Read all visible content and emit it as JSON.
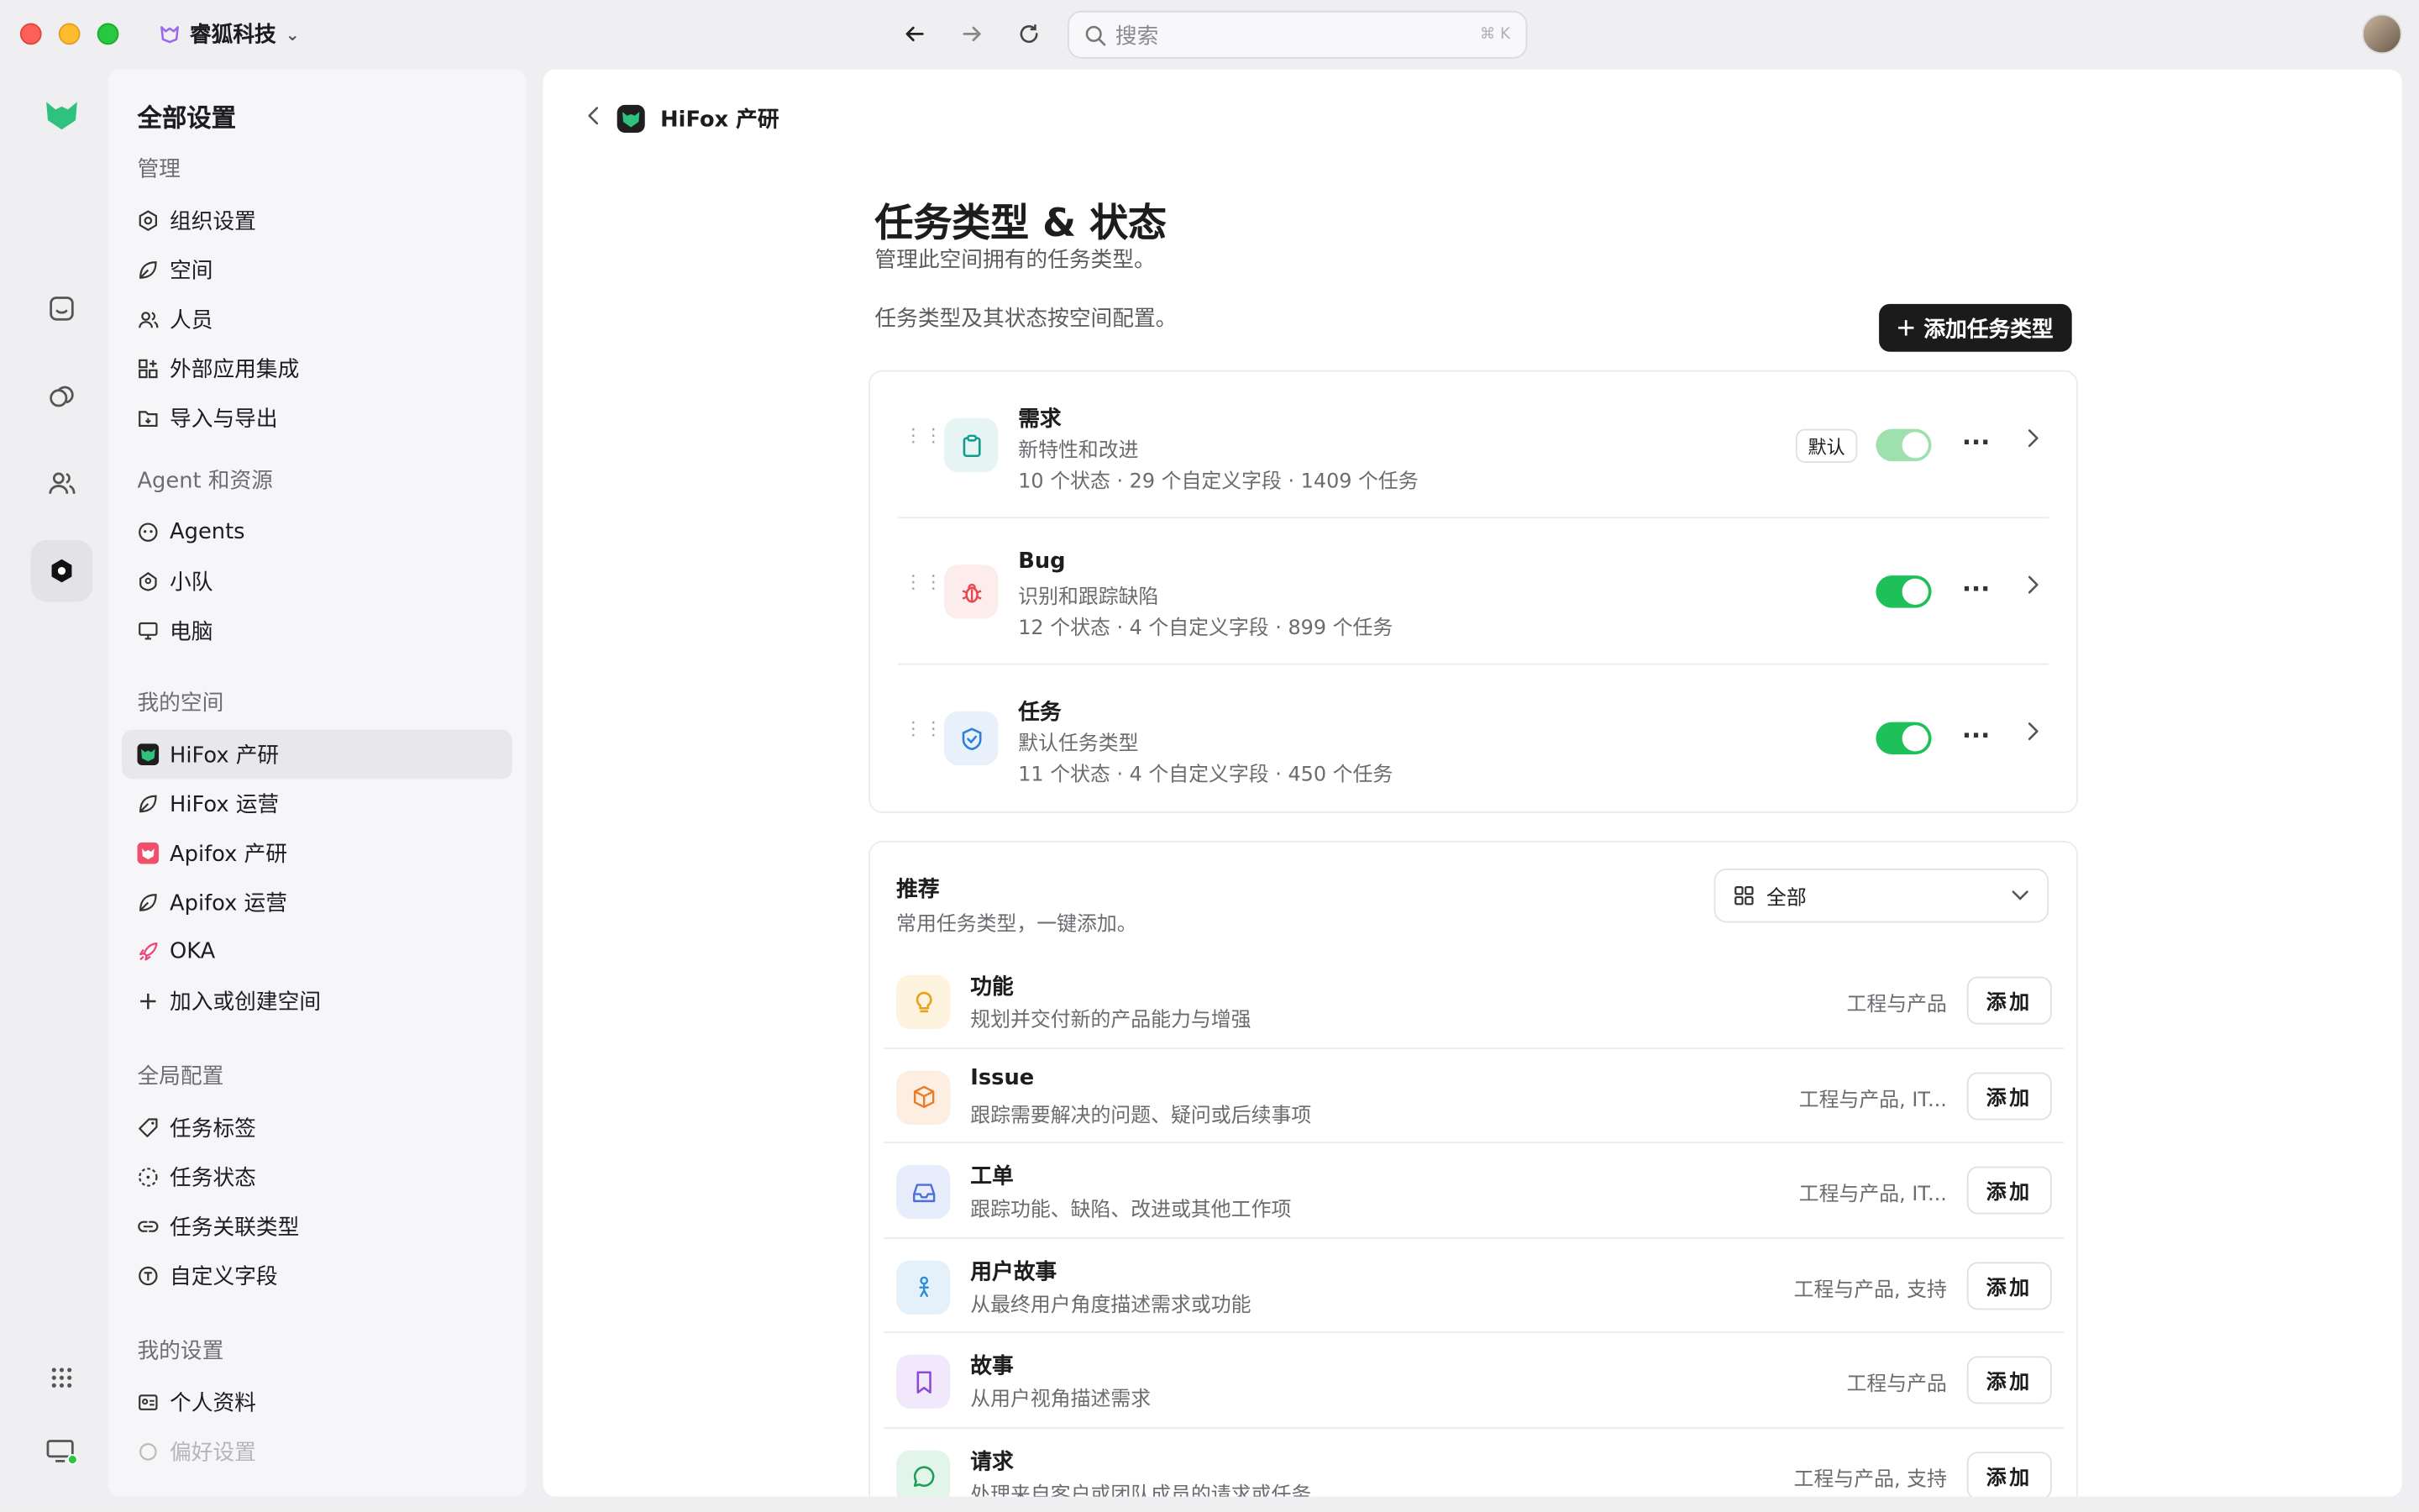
{
  "window": {
    "org_name": "睿狐科技"
  },
  "search": {
    "placeholder": "搜索",
    "shortcut": "⌘ K"
  },
  "sidebar": {
    "title": "全部设置",
    "sections": [
      {
        "label": "管理",
        "items": [
          {
            "label": "组织设置",
            "icon": "gear-icon"
          },
          {
            "label": "空间",
            "icon": "leaf-icon"
          },
          {
            "label": "人员",
            "icon": "people-icon"
          },
          {
            "label": "外部应用集成",
            "icon": "apps-icon"
          },
          {
            "label": "导入与导出",
            "icon": "folder-icon"
          }
        ]
      },
      {
        "label": "Agent 和资源",
        "items": [
          {
            "label": "Agents",
            "icon": "agent-icon"
          },
          {
            "label": "小队",
            "icon": "team-icon"
          },
          {
            "label": "电脑",
            "icon": "monitor-icon"
          }
        ]
      },
      {
        "label": "我的空间",
        "items": [
          {
            "label": "HiFox 产研",
            "icon": "hifox-logo-icon",
            "active": true
          },
          {
            "label": "HiFox 运营",
            "icon": "leaf-icon"
          },
          {
            "label": "Apifox 产研",
            "icon": "apifox-logo-icon"
          },
          {
            "label": "Apifox 运营",
            "icon": "leaf-icon"
          },
          {
            "label": "OKA",
            "icon": "rocket-icon"
          },
          {
            "label": "加入或创建空间",
            "icon": "plus-icon"
          }
        ]
      },
      {
        "label": "全局配置",
        "items": [
          {
            "label": "任务标签",
            "icon": "tag-icon"
          },
          {
            "label": "任务状态",
            "icon": "status-icon"
          },
          {
            "label": "任务关联类型",
            "icon": "link-icon"
          },
          {
            "label": "自定义字段",
            "icon": "field-icon"
          }
        ]
      },
      {
        "label": "我的设置",
        "items": [
          {
            "label": "个人资料",
            "icon": "profile-icon"
          },
          {
            "label": "偏好设置",
            "icon": "preferences-icon"
          }
        ]
      }
    ]
  },
  "breadcrumb": {
    "space": "HiFox 产研"
  },
  "page": {
    "title": "任务类型 & 状态",
    "subtitle": "管理此空间拥有的任务类型。",
    "note": "任务类型及其状态按空间配置。",
    "add_button": "添加任务类型"
  },
  "task_types": [
    {
      "name": "需求",
      "desc": "新特性和改进",
      "states": "10 个状态",
      "fields": "29 个自定义字段",
      "tasks": "1409 个任务",
      "badge": "默认",
      "enabled": true,
      "icon": "clipboard-icon",
      "color": "#0f9b8e",
      "bg": "#e6f5f3"
    },
    {
      "name": "Bug",
      "desc": "识别和跟踪缺陷",
      "states": "12 个状态",
      "fields": "4 个自定义字段",
      "tasks": "899 个任务",
      "badge": "",
      "enabled": true,
      "icon": "bug-icon",
      "color": "#e5484d",
      "bg": "#fdecec"
    },
    {
      "name": "任务",
      "desc": "默认任务类型",
      "states": "11 个状态",
      "fields": "4 个自定义字段",
      "tasks": "450 个任务",
      "badge": "",
      "enabled": true,
      "icon": "check-shield-icon",
      "color": "#2f7fd8",
      "bg": "#e7f0fb"
    }
  ],
  "recommend": {
    "title": "推荐",
    "subtitle": "常用任务类型，一键添加。",
    "filter_value": "全部",
    "add_label": "添加",
    "items": [
      {
        "name": "功能",
        "desc": "规划并交付新的产品能力与增强",
        "category": "工程与产品",
        "icon": "lightbulb-icon",
        "color": "#e8a21b",
        "bg": "#fdf3df"
      },
      {
        "name": "Issue",
        "desc": "跟踪需要解决的问题、疑问或后续事项",
        "category": "工程与产品, IT...",
        "icon": "box-icon",
        "color": "#ec7a26",
        "bg": "#fdeee2"
      },
      {
        "name": "工单",
        "desc": "跟踪功能、缺陷、改进或其他工作项",
        "category": "工程与产品, IT...",
        "icon": "inbox-icon",
        "color": "#4a6fd8",
        "bg": "#e8edfb"
      },
      {
        "name": "用户故事",
        "desc": "从最终用户角度描述需求或功能",
        "category": "工程与产品, 支持",
        "icon": "person-icon",
        "color": "#2a8ed8",
        "bg": "#e4f1fb"
      },
      {
        "name": "故事",
        "desc": "从用户视角描述需求",
        "category": "工程与产品",
        "icon": "bookmark-icon",
        "color": "#8b4ad8",
        "bg": "#f1e8fb"
      },
      {
        "name": "请求",
        "desc": "处理来自客户或团队成员的请求或任务",
        "category": "工程与产品, 支持",
        "icon": "chat-icon",
        "color": "#1e9e5a",
        "bg": "#e3f5ea"
      }
    ]
  }
}
